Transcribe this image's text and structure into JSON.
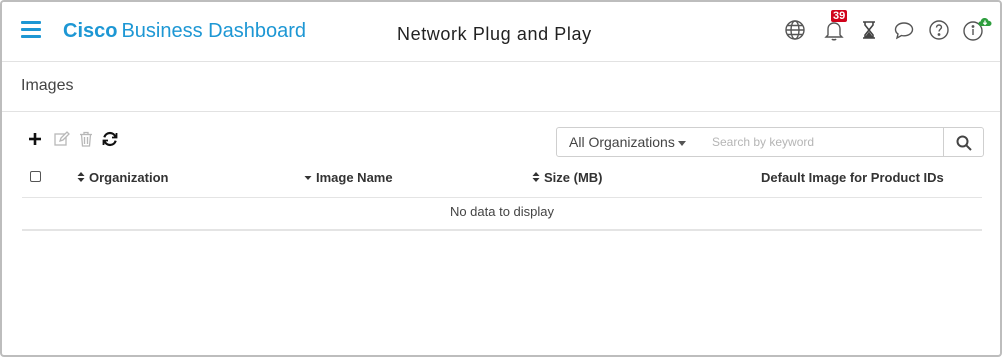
{
  "header": {
    "brand_bold": "Cisco",
    "brand_rest": "Business Dashboard",
    "page_title": "Network Plug and Play",
    "notification_count": "39",
    "icons": [
      "menu-icon",
      "globe-icon",
      "bell-icon",
      "hourglass-icon",
      "chat-icon",
      "help-icon",
      "info-icon"
    ]
  },
  "subheader": {
    "title": "Images"
  },
  "toolbar": {
    "icons": [
      "add-icon",
      "edit-icon",
      "delete-icon",
      "refresh-icon"
    ],
    "org_filter": "All Organizations",
    "search_placeholder": "Search by keyword"
  },
  "table": {
    "columns": [
      "Organization",
      "Image Name",
      "Size (MB)",
      "Default Image for Product IDs"
    ],
    "empty_message": "No data to display"
  },
  "colors": {
    "brand": "#1d97d4",
    "badge": "#d0021b",
    "update": "#2e9e3e"
  }
}
